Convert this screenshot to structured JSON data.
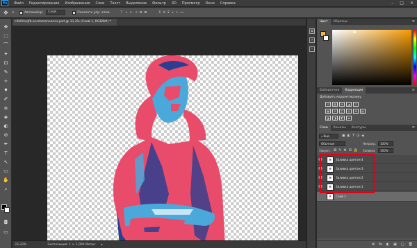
{
  "app": {
    "logo": "Ps"
  },
  "menu": [
    "Файл",
    "Редактирование",
    "Изображение",
    "Слои",
    "Текст",
    "Выделение",
    "Фильтр",
    "3D",
    "Просмотр",
    "Окно",
    "Справка"
  ],
  "window_controls": [
    "–",
    "□",
    "✕"
  ],
  "options_bar": {
    "tool_glyph": "✥",
    "auto_select_label": "Автовыбор:",
    "auto_select_value": "Слой",
    "show_controls_label": "Показать упр. элем."
  },
  "tools": [
    "✥",
    "⬚",
    "⌒",
    "✦",
    "⊡",
    "✎",
    "⟡",
    "♦",
    "✐",
    "⧈",
    "◈",
    "◐",
    "⊘",
    "✒",
    "T",
    "↖",
    "▭",
    "✋",
    "⌕"
  ],
  "document": {
    "tab_title": "cifelIVvzjfb-ecczamannanns.psd @ 33,3% (Слой 1, RGB/8#) *",
    "close": "×"
  },
  "status": {
    "zoom": "33,33%",
    "doc_info": "Экспозиция: 1 × 1,000 Метрс"
  },
  "strip_icons": [
    "grid-icon",
    "clock-icon",
    "info-icon"
  ],
  "color_panel": {
    "tabs": [
      "Цвет",
      "Образцы"
    ],
    "foreground_color": "#f2b04a",
    "background_color": "#ffffff"
  },
  "adjust_panel": {
    "tabs": [
      "Библиотеки",
      "Коррекция"
    ],
    "heading": "Добавить корректировку",
    "icons_row1": [
      "☼",
      "▥",
      "⊞",
      "◢",
      "▽"
    ],
    "icons_row2": [
      "▦",
      "⚖",
      "◫",
      "◎",
      "⊕",
      "▤"
    ],
    "icons_row3": [
      "◪",
      "◨",
      "◩",
      "▰"
    ]
  },
  "layers_panel": {
    "tabs": [
      "Слои",
      "Каналы",
      "Контуры"
    ],
    "filter_label": "Вид",
    "blend_mode": "Обычные",
    "opacity_label": "Непрозр.",
    "opacity_value": "100%",
    "lock_label": "Закреп.:",
    "fill_label": "Заливка",
    "fill_value": "100%",
    "layers": [
      {
        "name": "Заливка цветом 4",
        "visible": true,
        "thumb": "≡"
      },
      {
        "name": "Заливка цветом 3",
        "visible": true,
        "thumb": "≡"
      },
      {
        "name": "Заливка цветом 2",
        "visible": true,
        "thumb": "≡"
      },
      {
        "name": "Заливка цветом 1",
        "visible": true,
        "thumb": "≡"
      },
      {
        "name": "Слой 1",
        "visible": false,
        "thumb": "♠"
      }
    ],
    "footer_icons": [
      "⊗",
      "fx",
      "◐",
      "▣",
      "▢",
      "🗑"
    ]
  },
  "colors": {
    "pink": "#e84c6a",
    "blue": "#4aa9da",
    "navy": "#2c3e8f",
    "highlight_box": "#e3001b"
  }
}
